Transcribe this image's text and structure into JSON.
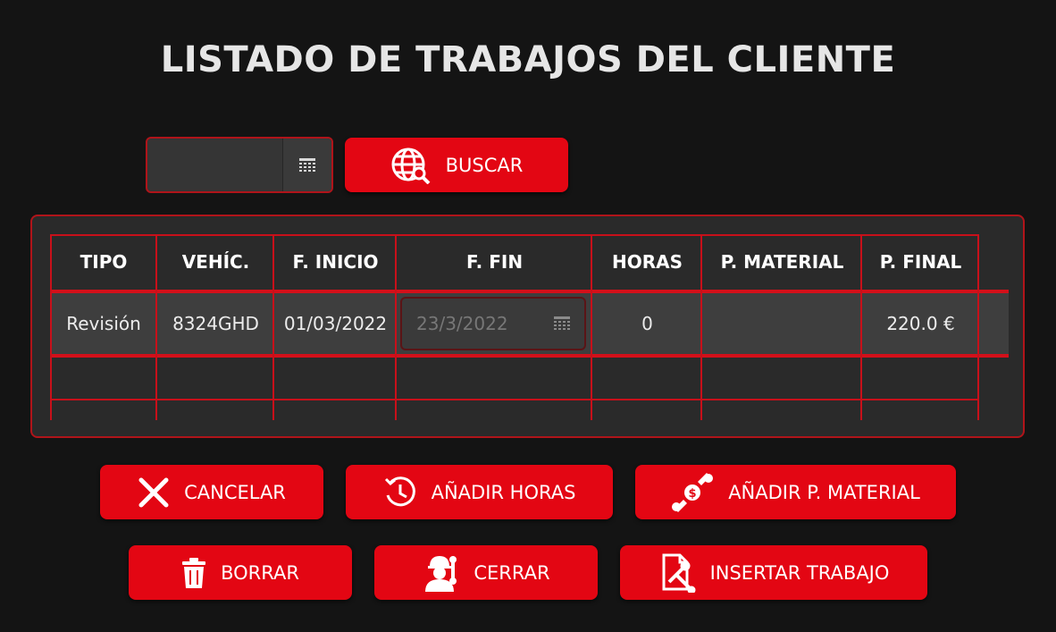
{
  "title": "LISTADO DE TRABAJOS DEL CLIENTE",
  "search": {
    "date_value": "",
    "button_label": "BUSCAR"
  },
  "table": {
    "headers": [
      "TIPO",
      "VEHÍC.",
      "F. INICIO",
      "F. FIN",
      "HORAS",
      "P. MATERIAL",
      "P. FINAL"
    ],
    "rows": [
      {
        "tipo": "Revisión",
        "vehiculo": "8324GHD",
        "f_inicio": "01/03/2022",
        "f_fin": "23/3/2022",
        "horas": "0",
        "p_material": "",
        "p_final": "220.0 €"
      }
    ]
  },
  "actions": {
    "cancel": "CANCELAR",
    "add_hours": "AÑADIR HORAS",
    "add_material": "AÑADIR P. MATERIAL",
    "delete": "BORRAR",
    "close": "CERRAR",
    "insert": "INSERTAR TRABAJO"
  },
  "colors": {
    "background": "#141414",
    "accent": "#e30613",
    "border": "#b0141a"
  }
}
